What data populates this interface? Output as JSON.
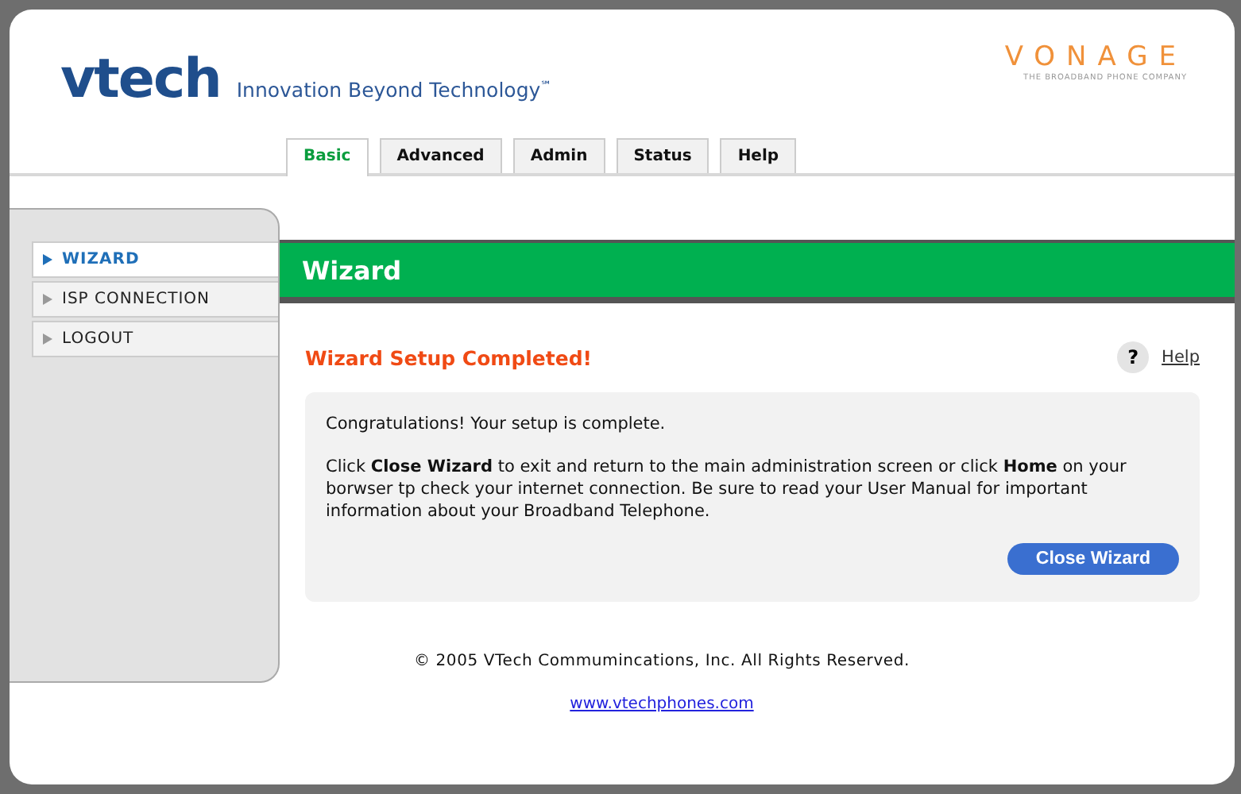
{
  "header": {
    "logo": "vtech",
    "tagline": "Innovation Beyond Technology",
    "tagline_mark": "℠",
    "partner_logo": "VONAGE",
    "partner_tagline": "THE BROADBAND PHONE COMPANY"
  },
  "tabs": [
    {
      "label": "Basic",
      "selected": true
    },
    {
      "label": "Advanced",
      "selected": false
    },
    {
      "label": "Admin",
      "selected": false
    },
    {
      "label": "Status",
      "selected": false
    },
    {
      "label": "Help",
      "selected": false
    }
  ],
  "sidebar": {
    "items": [
      {
        "label": "WIZARD",
        "selected": true
      },
      {
        "label": "ISP CONNECTION",
        "selected": false
      },
      {
        "label": "LOGOUT",
        "selected": false
      }
    ]
  },
  "section_title": "Wizard",
  "status_heading": "Wizard Setup Completed!",
  "help_icon": "?",
  "help_link": "Help",
  "panel": {
    "message": "Congratulations! Your setup is complete.",
    "instructions": "Click **Close Wizard** to exit and return to the main administration screen or click **Home** on your borwser tp check your internet connection. Be sure to read your User Manual for important information about your Broadband Telephone.",
    "button": "Close Wizard"
  },
  "footer": {
    "copyright": "© 2005 VTech Commumincations, Inc. All Rights Reserved.",
    "link": "www.vtechphones.com"
  }
}
